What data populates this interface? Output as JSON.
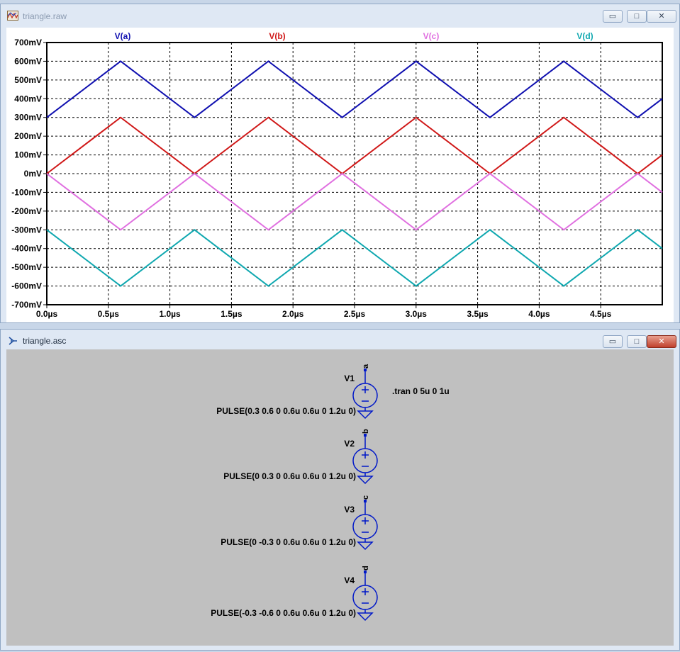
{
  "plot_window": {
    "title": "triangle.raw",
    "controls": {
      "minimize": "▭",
      "maximize": "□",
      "close": "✕"
    }
  },
  "schematic_window": {
    "title": "triangle.asc",
    "controls": {
      "minimize": "▭",
      "maximize": "□",
      "close": "✕"
    }
  },
  "colors": {
    "va": "#1010b0",
    "vb": "#d01818",
    "vc": "#e070e0",
    "vd": "#10a8b0",
    "schematic_blue": "#0018c8",
    "schematic_bg": "#c0c0c0"
  },
  "chart_data": {
    "type": "line",
    "xlim": [
      0,
      5.0
    ],
    "ylim": [
      -700,
      700
    ],
    "x_unit": "µs",
    "y_unit": "mV",
    "x_ticks": [
      "0.0µs",
      "0.5µs",
      "1.0µs",
      "1.5µs",
      "2.0µs",
      "2.5µs",
      "3.0µs",
      "3.5µs",
      "4.0µs",
      "4.5µs"
    ],
    "y_ticks": [
      "700mV",
      "600mV",
      "500mV",
      "400mV",
      "300mV",
      "200mV",
      "100mV",
      "0mV",
      "-100mV",
      "-200mV",
      "-300mV",
      "-400mV",
      "-500mV",
      "-600mV",
      "-700mV"
    ],
    "x_tick_values": [
      0,
      0.5,
      1.0,
      1.5,
      2.0,
      2.5,
      3.0,
      3.5,
      4.0,
      4.5
    ],
    "y_tick_values": [
      700,
      600,
      500,
      400,
      300,
      200,
      100,
      0,
      -100,
      -200,
      -300,
      -400,
      -500,
      -600,
      -700
    ],
    "grid": true,
    "series": [
      {
        "name": "V(a)",
        "color": "#1010b0",
        "x": [
          0,
          0.6,
          1.2,
          1.8,
          2.4,
          3.0,
          3.6,
          4.2,
          4.8,
          5.0
        ],
        "y": [
          300,
          600,
          300,
          600,
          300,
          600,
          300,
          600,
          300,
          400
        ]
      },
      {
        "name": "V(b)",
        "color": "#d01818",
        "x": [
          0,
          0.6,
          1.2,
          1.8,
          2.4,
          3.0,
          3.6,
          4.2,
          4.8,
          5.0
        ],
        "y": [
          0,
          300,
          0,
          300,
          0,
          300,
          0,
          300,
          0,
          100
        ]
      },
      {
        "name": "V(c)",
        "color": "#e070e0",
        "x": [
          0,
          0.6,
          1.2,
          1.8,
          2.4,
          3.0,
          3.6,
          4.2,
          4.8,
          5.0
        ],
        "y": [
          0,
          -300,
          0,
          -300,
          0,
          -300,
          0,
          -300,
          0,
          -100
        ]
      },
      {
        "name": "V(d)",
        "color": "#10a8b0",
        "x": [
          0,
          0.6,
          1.2,
          1.8,
          2.4,
          3.0,
          3.6,
          4.2,
          4.8,
          5.0
        ],
        "y": [
          -300,
          -600,
          -300,
          -600,
          -300,
          -600,
          -300,
          -600,
          -300,
          -400
        ]
      }
    ]
  },
  "schematic": {
    "directive": ".tran 0 5u 0 1u",
    "sources": [
      {
        "name": "V1",
        "node": "a",
        "value": "PULSE(0.3 0.6 0 0.6u 0.6u 0 1.2u 0)"
      },
      {
        "name": "V2",
        "node": "b",
        "value": "PULSE(0 0.3 0 0.6u 0.6u 0 1.2u 0)"
      },
      {
        "name": "V3",
        "node": "c",
        "value": "PULSE(0 -0.3 0 0.6u 0.6u 0 1.2u 0)"
      },
      {
        "name": "V4",
        "node": "d",
        "value": "PULSE(-0.3 -0.6 0 0.6u 0.6u 0 1.2u 0)"
      }
    ]
  }
}
